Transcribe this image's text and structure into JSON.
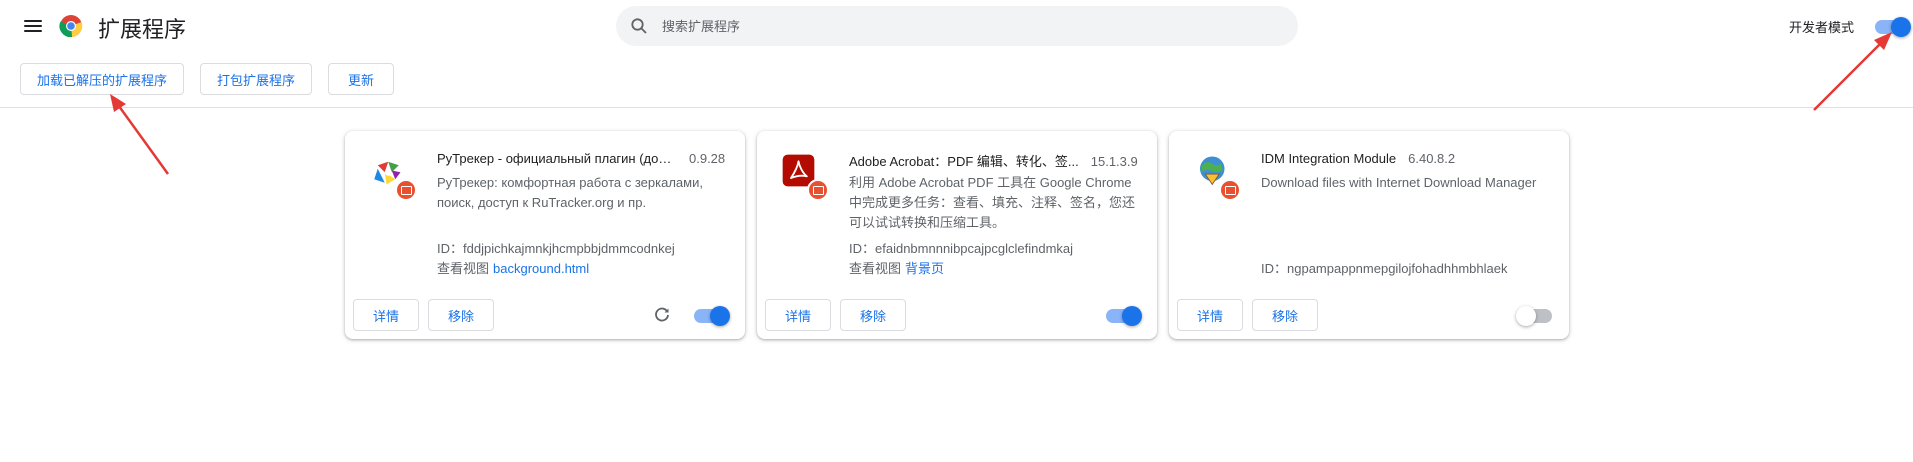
{
  "header": {
    "title": "扩展程序",
    "search_placeholder": "搜索扩展程序",
    "devmode_label": "开发者模式",
    "devmode_on": true
  },
  "toolbar": {
    "load_unpacked": "加载已解压的扩展程序",
    "pack": "打包扩展程序",
    "update": "更新"
  },
  "extensions": [
    {
      "name": "РуТрекер - официальный плагин (дост...",
      "version": "0.9.28",
      "description": "РуТрекер: комфортная работа с зеркалами, поиск, доступ к RuTracker.org и пр.",
      "id_label": "ID：",
      "id": "fddjpichkajmnkjhcmpbbjdmmcodnkej",
      "views_label": "查看视图",
      "views_link": "background.html",
      "details": "详情",
      "remove": "移除",
      "enabled": true,
      "icon": "rutracker-icon"
    },
    {
      "name": "Adobe Acrobat：PDF 编辑、转化、签...",
      "version": "15.1.3.9",
      "description": "利用 Adobe Acrobat PDF 工具在 Google Chrome 中完成更多任务：查看、填充、注释、签名，您还可以试试转换和压缩工具。",
      "id_label": "ID：",
      "id": "efaidnbmnnnibpcajpcglclefindmkaj",
      "views_label": "查看视图",
      "views_link": "背景页",
      "details": "详情",
      "remove": "移除",
      "enabled": true,
      "icon": "adobe-acrobat-icon"
    },
    {
      "name": "IDM Integration Module",
      "version": "6.40.8.2",
      "description": "Download files with Internet Download Manager",
      "id_label": "ID：",
      "id": "ngpampappnmepgilojfohadhhmbhlaek",
      "details": "详情",
      "remove": "移除",
      "enabled": false,
      "icon": "idm-icon"
    }
  ],
  "colors": {
    "accent": "#1a73e8",
    "annotation_arrow": "#e53935"
  }
}
